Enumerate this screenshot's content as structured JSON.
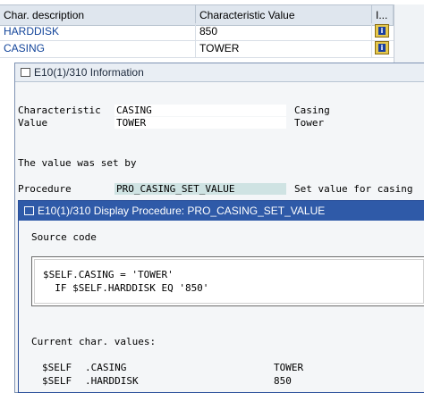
{
  "table": {
    "headers": [
      "Char. description",
      "Characteristic Value",
      "I..."
    ],
    "rows": [
      {
        "description": "HARDDISK",
        "value": "850",
        "info_icon": "info-icon"
      },
      {
        "description": "CASING",
        "value": "TOWER",
        "info_icon": "info-icon"
      }
    ]
  },
  "info_dialog": {
    "title": "E10(1)/310 Information",
    "characteristic_label": "Characteristic",
    "characteristic_value": "CASING",
    "characteristic_text": "Casing",
    "value_label": "Value",
    "value_value": "TOWER",
    "value_text": "Tower",
    "set_by_text": "The value was set by",
    "procedure_label": "Procedure",
    "procedure_value": "PRO_CASING_SET_VALUE",
    "procedure_text": "Set value for casing"
  },
  "procedure_dialog": {
    "title": "E10(1)/310 Display Procedure: PRO_CASING_SET_VALUE",
    "source_code_label": "Source code",
    "code_lines": [
      "$SELF.CASING = 'TOWER'",
      "  IF $SELF.HARDDISK EQ '850'"
    ],
    "current_values_label": "Current char. values:",
    "current_values": [
      {
        "object": "$SELF",
        "char": ".CASING",
        "value": "TOWER"
      },
      {
        "object": "$SELF",
        "char": ".HARDDISK",
        "value": "850"
      }
    ]
  },
  "colors": {
    "title_bar_active": "#2f5aa8",
    "link_blue": "#12449a",
    "info_button": "#e5c84d"
  }
}
